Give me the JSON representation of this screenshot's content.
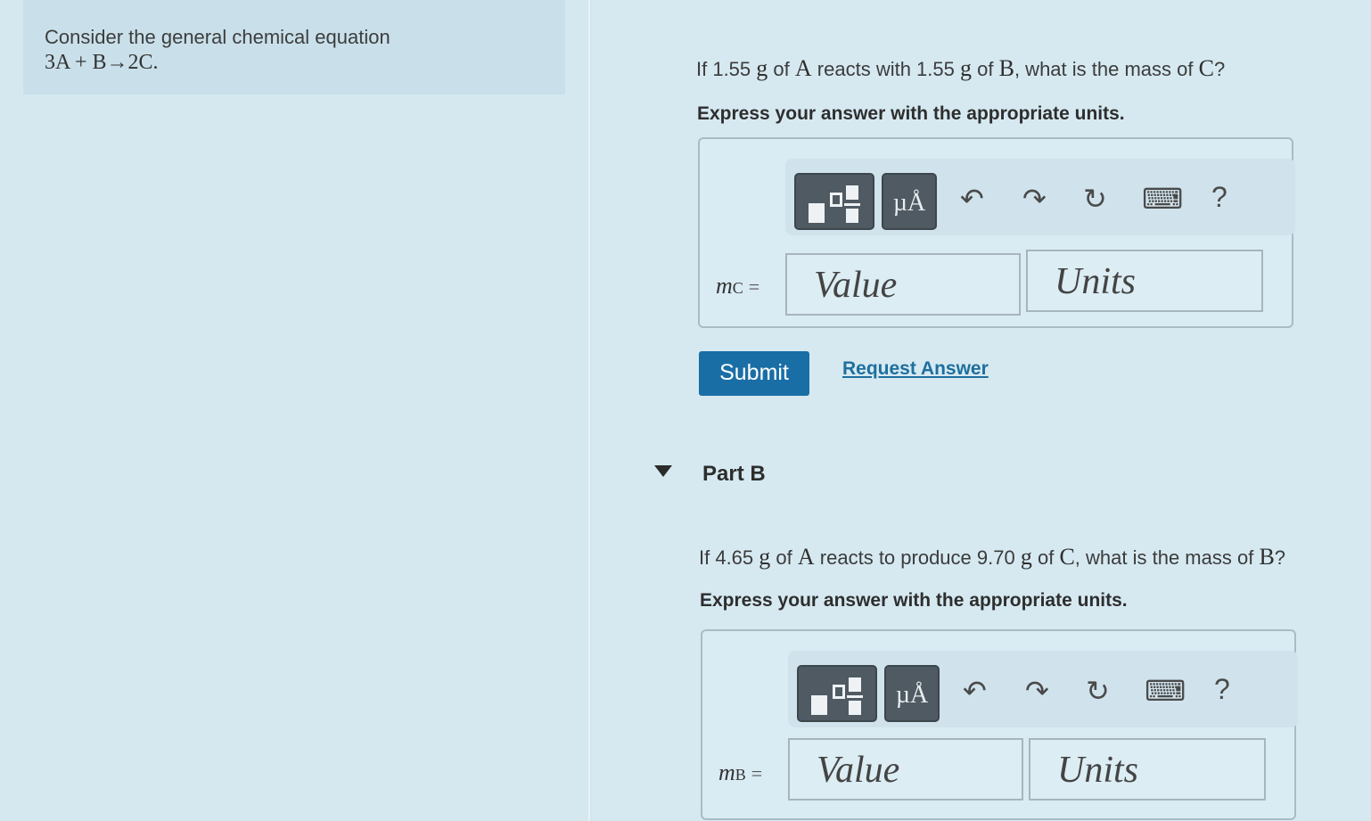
{
  "intro": {
    "text": "Consider the general chemical equation",
    "equation": "3A + B→2C."
  },
  "part_a": {
    "question": {
      "p1": "If 1.55",
      "u1": "g",
      "p2": "of",
      "v1": "A",
      "p3": "reacts with 1.55",
      "u2": "g",
      "p4": "of",
      "v2": "B",
      "p5": ", what is the mass of",
      "v3": "C",
      "p6": "?"
    },
    "instruction": "Express your answer with the appropriate units.",
    "variable": "m",
    "variable_sub": "C",
    "equals": "=",
    "value_placeholder": "Value",
    "units_placeholder": "Units"
  },
  "toolbar": {
    "units_symbol": "µÅ",
    "undo_icon": "↶",
    "redo_icon": "↷",
    "reset_icon": "↻",
    "keyboard_icon": "⌨",
    "help_label": "?"
  },
  "actions": {
    "submit_label": "Submit",
    "request_answer_label": "Request Answer"
  },
  "part_b": {
    "title": "Part B",
    "question": {
      "p1": "If 4.65",
      "u1": "g",
      "p2": "of",
      "v1": "A",
      "p3": "reacts to produce 9.70",
      "u2": "g",
      "p4": "of",
      "v2": "C",
      "p5": ", what is the mass of",
      "v3": "B",
      "p6": "?"
    },
    "instruction": "Express your answer with the appropriate units.",
    "variable": "m",
    "variable_sub": "B",
    "equals": "=",
    "value_placeholder": "Value",
    "units_placeholder": "Units"
  },
  "colors": {
    "submit_bg": "#1a6ea6",
    "link": "#1e6f9e",
    "toolbar_button": "#4f5a62"
  }
}
